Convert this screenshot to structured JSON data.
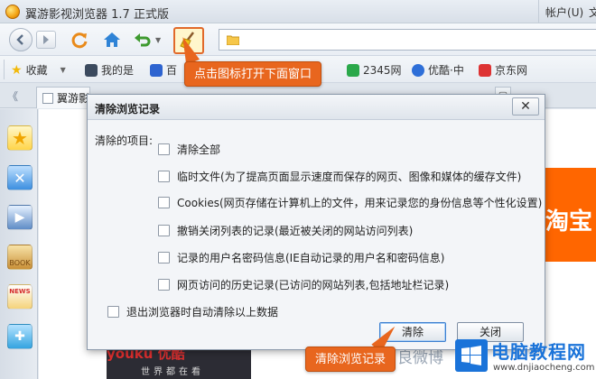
{
  "window": {
    "title": "翼游影视浏览器 1.7 正式版",
    "account_label": "帐户",
    "account_hotkey": "(U)",
    "account_extra": "文"
  },
  "favorites": [
    {
      "label": "收藏",
      "icon": "star-icon",
      "color": "#f2b90a"
    },
    {
      "label": "我的是",
      "icon": "bookmark-icon",
      "color": "#3b4a5e"
    },
    {
      "label": "百",
      "icon": "paw-icon",
      "color": "#2d64d0"
    },
    {
      "label": "2345网",
      "icon": "2345-icon",
      "color": "#2aa84a"
    },
    {
      "label": "优酷·中",
      "icon": "play-icon",
      "color": "#2e6fd8"
    },
    {
      "label": "京东网",
      "icon": "jd-icon",
      "color": "#d33"
    }
  ],
  "tabs": [
    {
      "label": "翼游影"
    }
  ],
  "callouts": {
    "top": "点击图标打开下面窗口",
    "bottom": "清除浏览记录"
  },
  "dialog": {
    "title": "清除浏览记录",
    "close_glyph": "✕",
    "items_label": "清除的项目:",
    "options": [
      "清除全部",
      "临时文件(为了提高页面显示速度而保存的网页、图像和媒体的缓存文件)",
      "Cookies(网页存储在计算机上的文件，用来记录您的身份信息等个性化设置)",
      "撤销关闭列表的记录(最近被关闭的网站访问列表)",
      "记录的用户名密码信息(IE自动记录的用户名和密码信息)",
      "网页访问的历史记录(已访问的网站列表,包括地址栏记录)"
    ],
    "auto_clear_label": "退出浏览器时自动清除以上数据",
    "clear_button": "清除",
    "close_button": "关闭"
  },
  "page": {
    "banner_text": "淘宝",
    "youku_logo": "youku 优酷",
    "youku_slogan": "世界都在看",
    "faint_text": "良微博"
  },
  "watermark": {
    "title": "电脑教程网",
    "url": "www.dnjiaocheng.com"
  },
  "colors": {
    "accent": "#e8661e",
    "dialog_bg": "#f3f5f8",
    "brand_blue": "#1a73d9"
  }
}
